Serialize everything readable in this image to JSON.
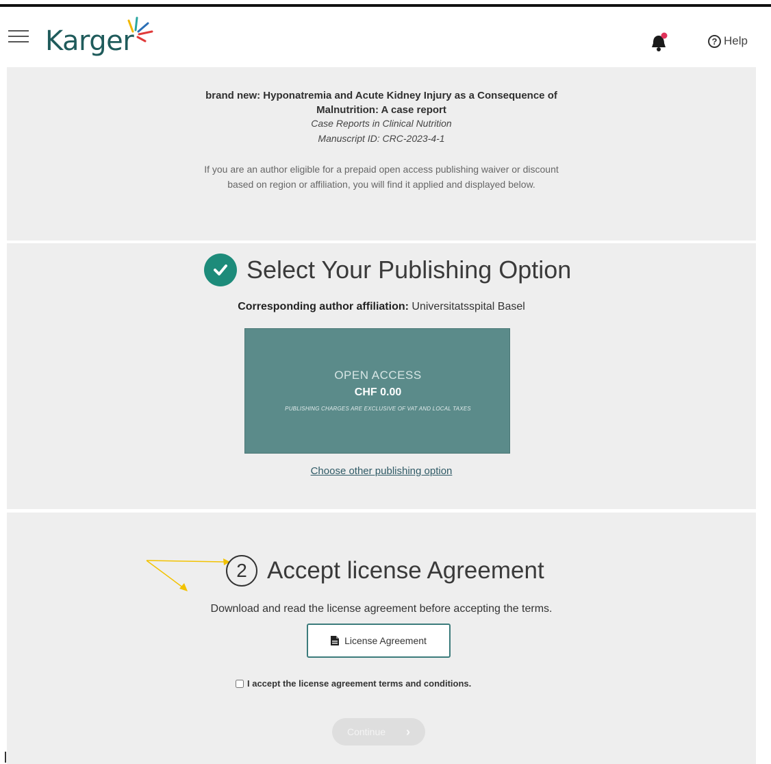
{
  "header": {
    "logo_text": "Karger",
    "help_label": "Help",
    "help_symbol": "?",
    "brand_color": "#1f5b5b"
  },
  "manuscript": {
    "title": "brand new: Hyponatremia and Acute Kidney Injury as a Consequence of Malnutrition: A case report",
    "journal": "Case Reports in Clinical Nutrition",
    "manuscript_id": "Manuscript ID: CRC-2023-4-1",
    "info": "If you are an author eligible for a prepaid open access publishing waiver or discount based on region or affiliation, you will find it applied and displayed below."
  },
  "publishing_option": {
    "title": "Select Your Publishing Option",
    "affiliation_label": "Corresponding author affiliation:",
    "affiliation_value": "Universitatsspital Basel",
    "card": {
      "label": "OPEN ACCESS",
      "price": "CHF 0.00",
      "note": "PUBLISHING CHARGES ARE EXCLUSIVE OF VAT AND LOCAL TAXES",
      "color": "#5b8b8a"
    },
    "choose_other_link": "Choose other publishing option",
    "check_color": "#1d8b7a"
  },
  "license": {
    "step_number": "2",
    "title": "Accept license Agreement",
    "description": "Download and read the license agreement before accepting the terms.",
    "button_label": "License Agreement",
    "accept_label": "I accept the license agreement terms and conditions.",
    "continue_label": "Continue",
    "annotation_color": "#f2c200"
  }
}
